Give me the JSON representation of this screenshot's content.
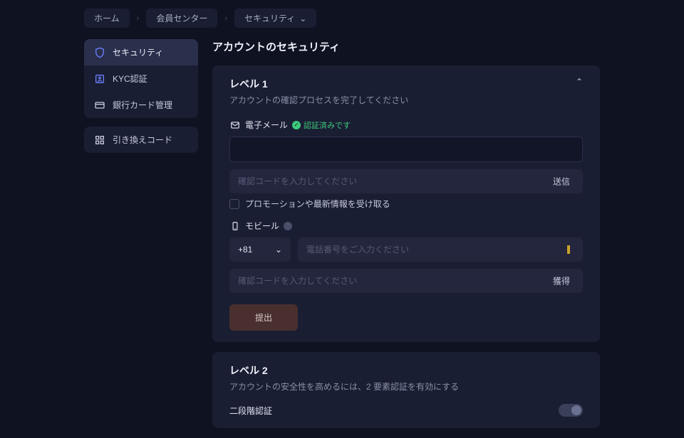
{
  "breadcrumb": {
    "items": [
      "ホーム",
      "会員センター",
      "セキュリティ"
    ]
  },
  "sidebar": {
    "group1": [
      {
        "label": "セキュリティ",
        "icon": "shield"
      },
      {
        "label": "KYC認証",
        "icon": "id"
      },
      {
        "label": "銀行カード管理",
        "icon": "card"
      }
    ],
    "group2": [
      {
        "label": "引き換えコード",
        "icon": "qr"
      }
    ]
  },
  "page": {
    "title": "アカウントのセキュリティ"
  },
  "level1": {
    "title": "レベル 1",
    "subtitle": "アカウントの確認プロセスを完了してください",
    "email": {
      "label": "電子メール",
      "verified": "認証済みです"
    },
    "code_placeholder": "確認コードを入力してください",
    "send": "送信",
    "promo": "プロモーションや最新情報を受け取る",
    "mobile": {
      "label": "モビール",
      "country": "+81",
      "placeholder": "電話番号をご入力ください"
    },
    "code2_placeholder": "確認コードを入力してください",
    "get": "獲得",
    "submit": "提出"
  },
  "level2": {
    "title": "レベル 2",
    "subtitle": "アカウントの安全性を高めるには、2 要素認証を有効にする",
    "twofa": "二段階認証"
  }
}
